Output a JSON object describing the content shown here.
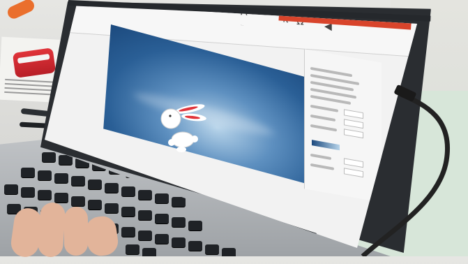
{
  "powerpoint": {
    "title_bar_text": "",
    "format_pane_title": ""
  },
  "colors": {
    "ribbon_accent": "#d8442b",
    "slide_background": "#2a5f96",
    "bunny_ears": "#e0333a"
  }
}
